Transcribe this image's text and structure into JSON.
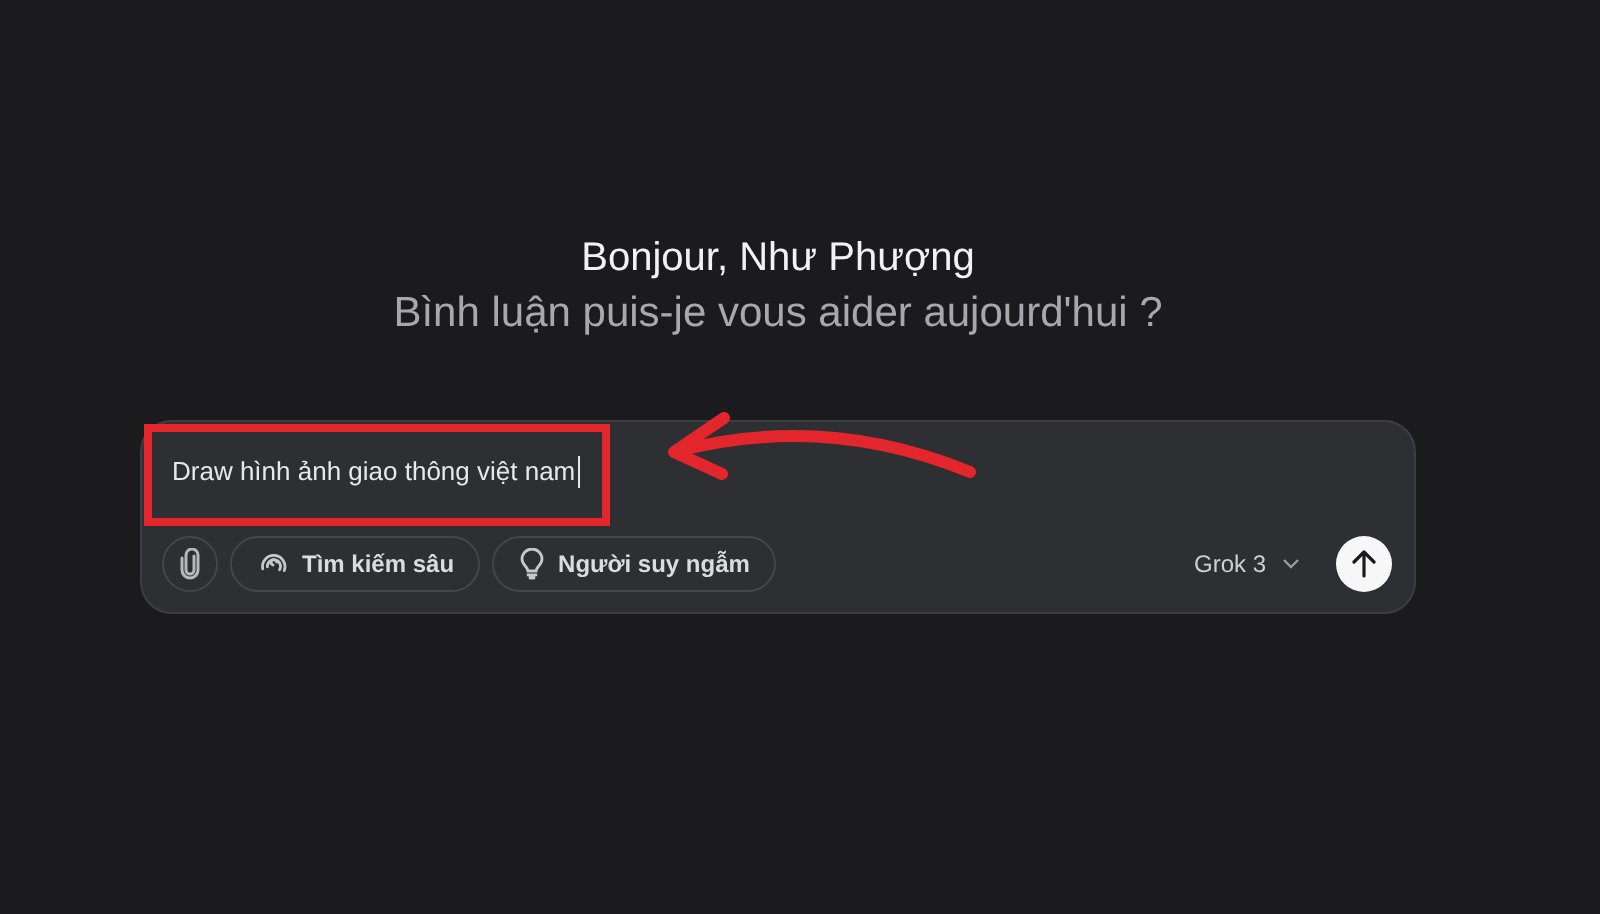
{
  "greeting": {
    "title": "Bonjour, Như Phượng",
    "subtitle": "Bình luận puis-je vous aider aujourd'hui ?"
  },
  "composer": {
    "value": "Draw hình ảnh giao thông việt nam",
    "focused": true,
    "tools": [
      {
        "kind": "attach"
      },
      {
        "kind": "deepsearch",
        "label": "Tìm kiếm sâu"
      },
      {
        "kind": "think",
        "label": "Người suy ngẫm"
      }
    ],
    "model": "Grok 3"
  }
}
